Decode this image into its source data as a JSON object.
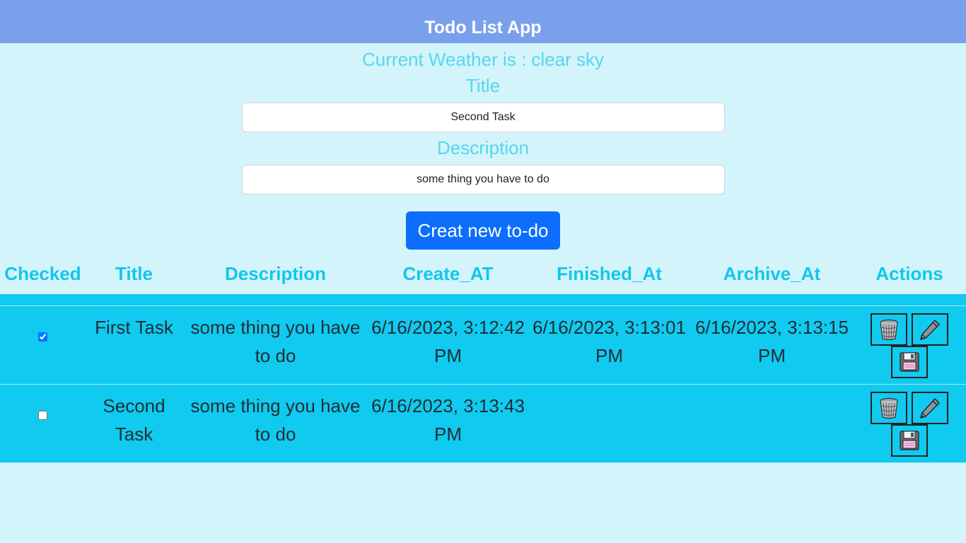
{
  "header": {
    "title": "Todo List App"
  },
  "weather": {
    "text": "Current Weather is : clear sky"
  },
  "form": {
    "title_label": "Title",
    "title_value": "Second Task",
    "description_label": "Description",
    "description_value": "some thing you have to do",
    "create_button": "Creat new to-do"
  },
  "table": {
    "headers": {
      "checked": "Checked",
      "title": "Title",
      "description": "Description",
      "created": "Create_AT",
      "finished": "Finished_At",
      "archived": "Archive_At",
      "actions": "Actions"
    },
    "rows": [
      {
        "checked": true,
        "title": "First Task",
        "description": "some thing you have to do",
        "created": "6/16/2023, 3:12:42 PM",
        "finished": "6/16/2023, 3:13:01 PM",
        "archived": "6/16/2023, 3:13:15 PM"
      },
      {
        "checked": false,
        "title": "Second Task",
        "description": "some thing you have to do",
        "created": "6/16/2023, 3:13:43 PM",
        "finished": "",
        "archived": ""
      }
    ],
    "action_icons": [
      "trash-icon",
      "pencil-icon",
      "floppy-disk-icon"
    ]
  },
  "colors": {
    "header_bg": "#7aa0ec",
    "page_bg": "#d3f4fa",
    "accent_text": "#56d6f0",
    "heading_text": "#12c6ee",
    "row_bg": "#10caf0",
    "button_bg": "#0d6efd"
  }
}
